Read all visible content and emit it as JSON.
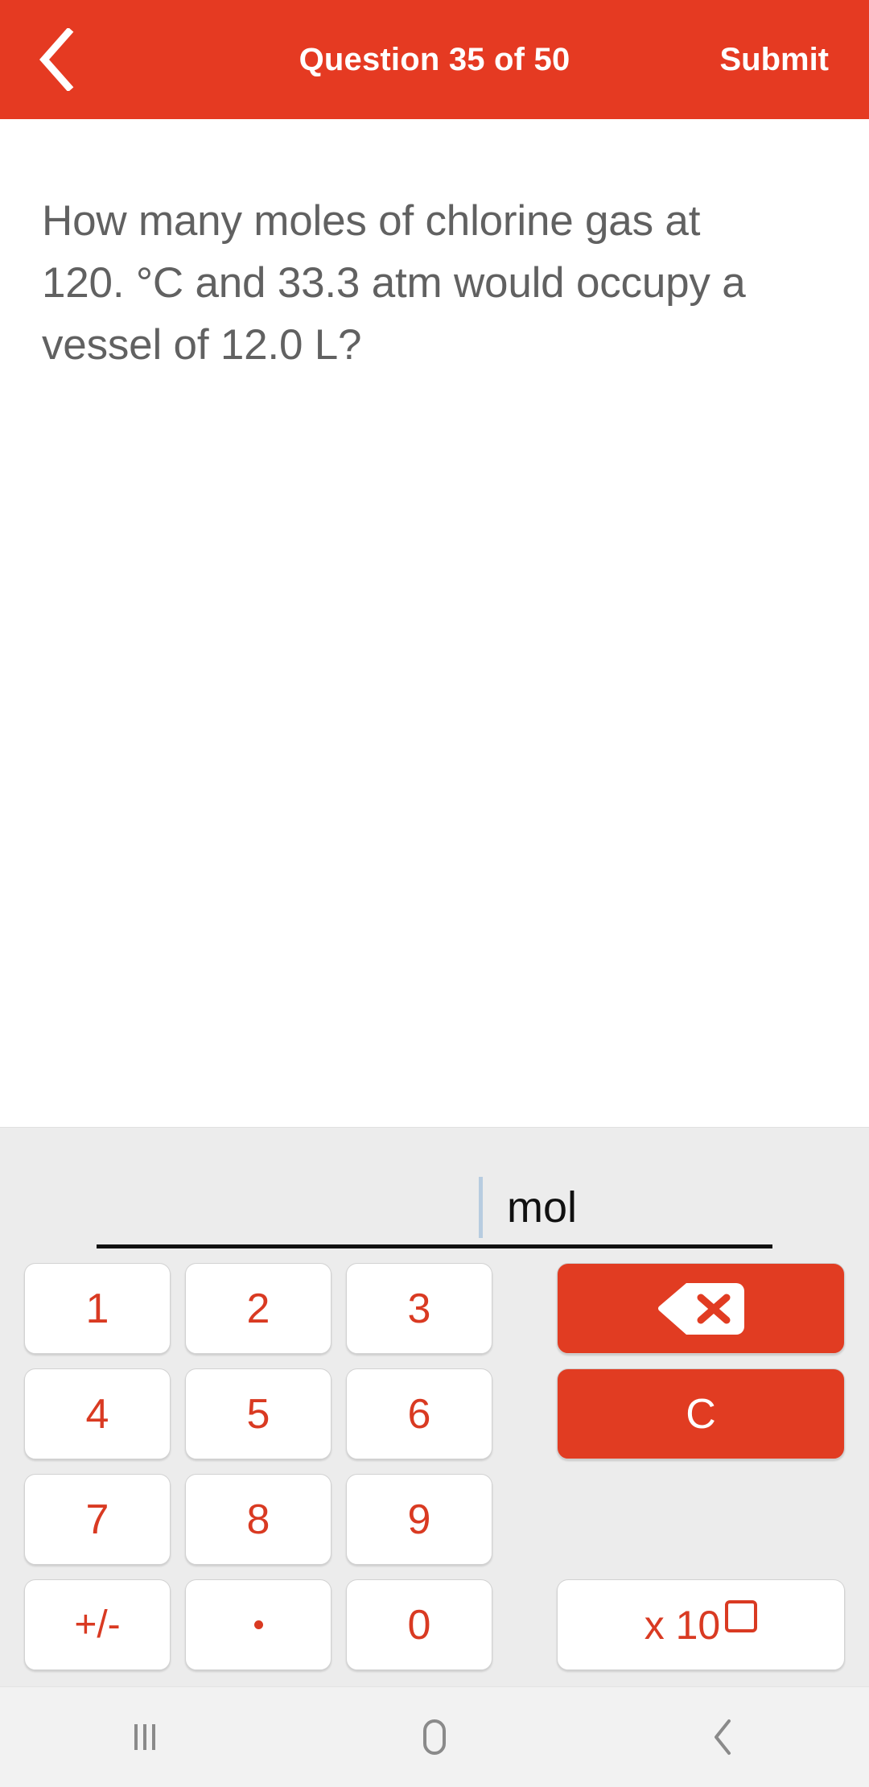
{
  "header": {
    "back_icon": "chevron-left-icon",
    "title": "Question 35 of 50",
    "submit_label": "Submit",
    "background_color": "#E53A22",
    "text_color": "#FFFFFF"
  },
  "question": {
    "text": "How many moles of chlorine gas at 120. °C and 33.3 atm would occupy a vessel of 12.0 L?",
    "text_color": "#616161"
  },
  "answer_input": {
    "value": "",
    "placeholder": "",
    "unit": "mol",
    "caret_color": "#B7CCE0",
    "underline_color": "#111111"
  },
  "keypad": {
    "panel_color": "#ECECEC",
    "key_text_color": "#D93A22",
    "accent_color": "#E13C22",
    "number_keys": [
      {
        "label": "1",
        "name": "key-1"
      },
      {
        "label": "2",
        "name": "key-2"
      },
      {
        "label": "3",
        "name": "key-3"
      },
      {
        "label": "4",
        "name": "key-4"
      },
      {
        "label": "5",
        "name": "key-5"
      },
      {
        "label": "6",
        "name": "key-6"
      },
      {
        "label": "7",
        "name": "key-7"
      },
      {
        "label": "8",
        "name": "key-8"
      },
      {
        "label": "9",
        "name": "key-9"
      },
      {
        "label": "+/-",
        "name": "key-plus-minus"
      },
      {
        "label": ".",
        "name": "key-decimal"
      },
      {
        "label": "0",
        "name": "key-0"
      }
    ],
    "backspace": {
      "icon": "backspace-icon",
      "label": ""
    },
    "clear": {
      "label": "C",
      "name": "key-clear"
    },
    "scientific": {
      "base_label": "x 10",
      "exponent_placeholder": ""
    }
  },
  "nav_bar": {
    "background_color": "#F2F2F2",
    "items": [
      {
        "name": "recents-icon",
        "label": ""
      },
      {
        "name": "home-icon",
        "label": ""
      },
      {
        "name": "back-icon",
        "label": ""
      }
    ]
  }
}
